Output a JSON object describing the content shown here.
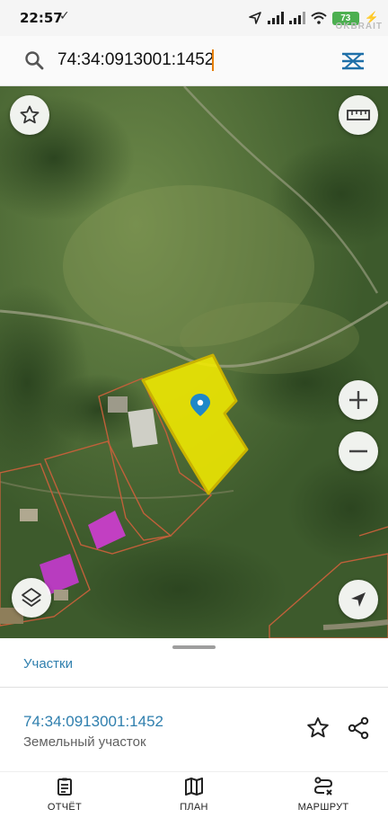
{
  "status_bar": {
    "time": "22:57",
    "check_icon": "check-icon",
    "battery": "73",
    "watermark": "OKBRAIT"
  },
  "search": {
    "value": "74:34:0913001:1452",
    "placeholder": ""
  },
  "map": {
    "parcel_color": "#f2ea00",
    "parcel_outline": "#b8a300",
    "boundary_color": "#c0603a",
    "pin_color": "#1e88c8",
    "buttons": {
      "favorite": "star-icon",
      "ruler": "ruler-icon",
      "zoom_in": "plus-icon",
      "zoom_out": "minus-icon",
      "layers": "layers-icon",
      "locate": "navigation-arrow-icon"
    }
  },
  "sheet": {
    "tab_label": "Участки",
    "parcel_id": "74:34:0913001:1452",
    "parcel_type": "Земельный участок"
  },
  "nav": {
    "items": [
      {
        "label": "ОТЧЁТ",
        "icon": "clipboard-icon"
      },
      {
        "label": "ПЛАН",
        "icon": "map-icon"
      },
      {
        "label": "МАРШРУТ",
        "icon": "route-icon"
      }
    ]
  },
  "colors": {
    "accent": "#2f7fae",
    "menu_icon": "#1e6fa8"
  }
}
